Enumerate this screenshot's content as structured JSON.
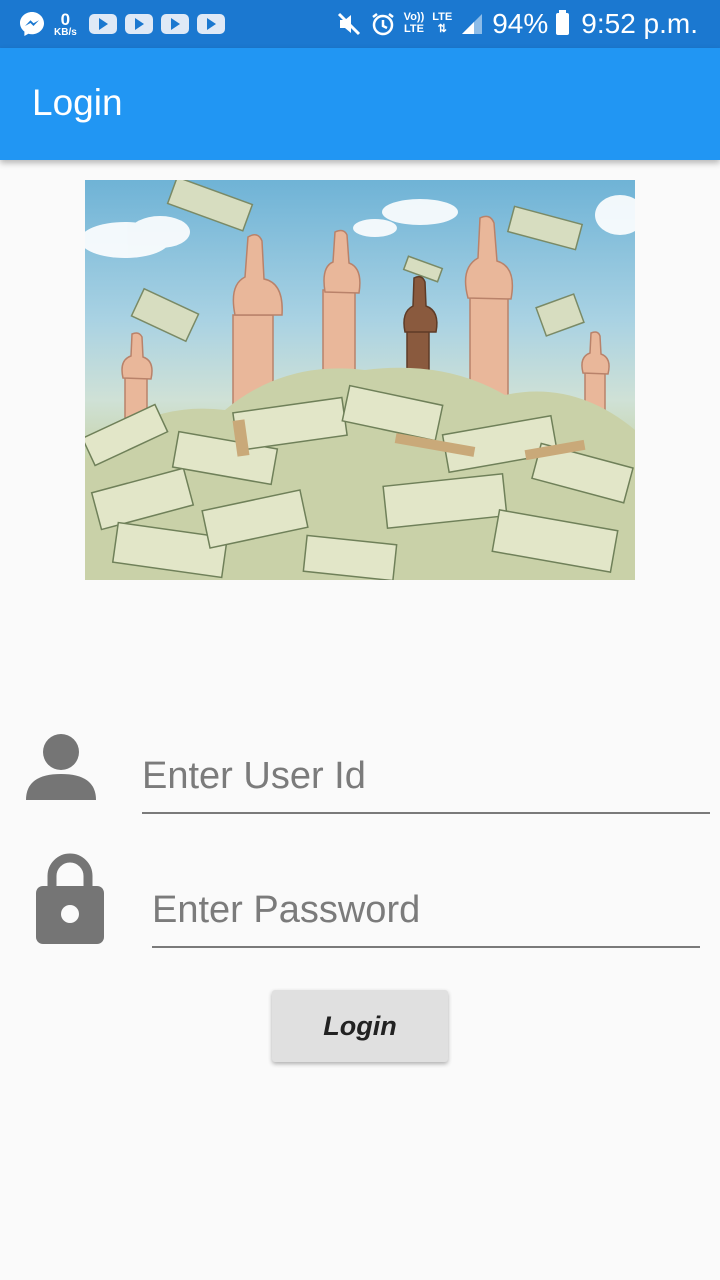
{
  "status_bar": {
    "net_speed_value": "0",
    "net_speed_unit": "KB/s",
    "volte_top": "Vo))",
    "volte_bottom": "LTE",
    "lte_label": "LTE",
    "battery": "94%",
    "time": "9:52 p.m.",
    "icons": [
      "messenger-icon",
      "youtube-icon",
      "youtube-icon",
      "youtube-icon",
      "youtube-icon",
      "mute-icon",
      "alarm-icon",
      "signal-icon",
      "battery-icon"
    ]
  },
  "app_bar": {
    "title": "Login"
  },
  "form": {
    "user_id_placeholder": "Enter User Id",
    "password_placeholder": "Enter Password",
    "login_label": "Login"
  },
  "colors": {
    "status_bar": "#1b78d0",
    "app_bar": "#2196f3",
    "background": "#fafafa",
    "button": "#e0e0e0",
    "icon_gray": "#757575"
  }
}
